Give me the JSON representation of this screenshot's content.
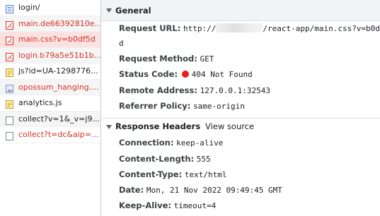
{
  "requests": [
    {
      "name": "login/",
      "icon": "document-icon",
      "error": false,
      "selected": false
    },
    {
      "name": "main.de66392810e...",
      "icon": "stylesheet-icon",
      "error": true,
      "selected": false
    },
    {
      "name": "main.css?v=b0df5d",
      "icon": "stylesheet-icon",
      "error": true,
      "selected": true
    },
    {
      "name": "login.b79a5e51b1b...",
      "icon": "stylesheet-icon",
      "error": true,
      "selected": false
    },
    {
      "name": "js?id=UA-1298776...",
      "icon": "script-icon",
      "error": false,
      "selected": false
    },
    {
      "name": "opossum_hanging....",
      "icon": "image-icon",
      "error": true,
      "selected": false
    },
    {
      "name": "analytics.js",
      "icon": "script-icon",
      "error": false,
      "selected": false
    },
    {
      "name": "collect?v=1&_v=j9...",
      "icon": "generic-file-icon",
      "error": false,
      "selected": false
    },
    {
      "name": "collect?t=dc&aip=...",
      "icon": "generic-file-icon",
      "error": true,
      "selected": false
    }
  ],
  "general": {
    "title": "General",
    "request_url_label": "Request URL:",
    "request_url_prefix": "http://",
    "request_url_path": "/react-app/main.css?v=b0df5",
    "request_url_wrap": "d",
    "request_method_label": "Request Method:",
    "request_method": "GET",
    "status_code_label": "Status Code:",
    "status_code": "404 Not Found",
    "status_color": "#ea1c1c",
    "remote_address_label": "Remote Address:",
    "remote_address": "127.0.0.1:32543",
    "referrer_policy_label": "Referrer Policy:",
    "referrer_policy": "same-origin"
  },
  "response_headers": {
    "title": "Response Headers",
    "view_source": "View source",
    "items": [
      {
        "key": "Connection:",
        "value": "keep-alive"
      },
      {
        "key": "Content-Length:",
        "value": "555"
      },
      {
        "key": "Content-Type:",
        "value": "text/html"
      },
      {
        "key": "Date:",
        "value": "Mon, 21 Nov 2022 09:49:45 GMT"
      },
      {
        "key": "Keep-Alive:",
        "value": "timeout=4"
      }
    ]
  }
}
